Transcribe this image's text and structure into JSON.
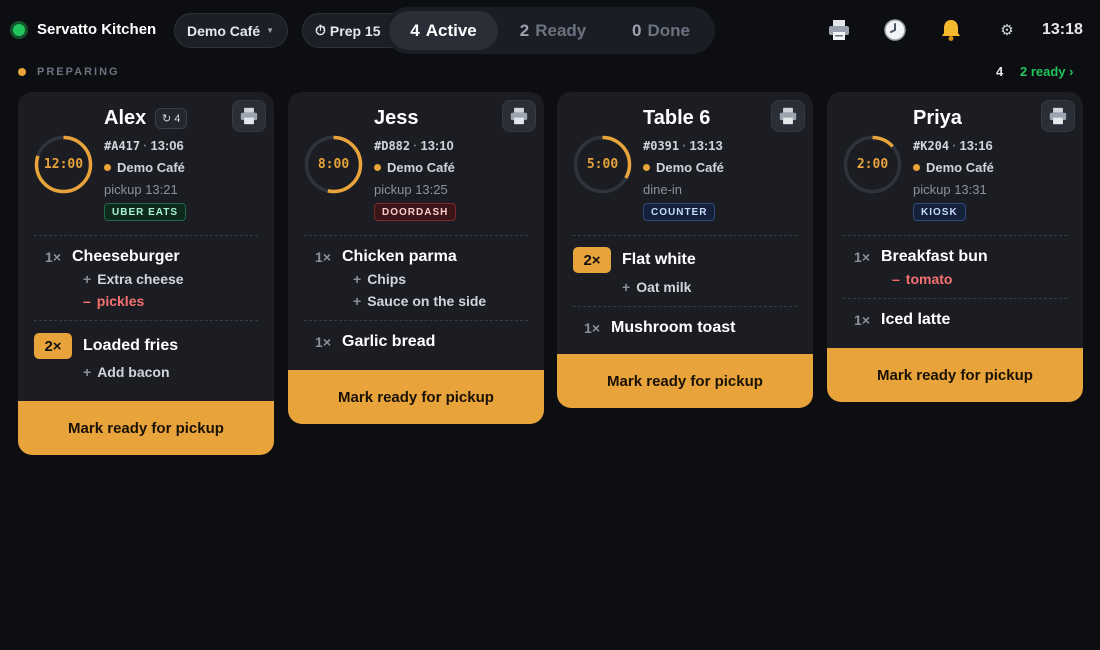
{
  "header": {
    "app_title": "Servatto Kitchen",
    "location": "Demo Café",
    "prep": "Prep 15",
    "prep_icon": "⏱",
    "tabs": [
      {
        "count": "4",
        "label": "Active"
      },
      {
        "count": "2",
        "label": "Ready"
      },
      {
        "count": "0",
        "label": "Done"
      }
    ],
    "icons": {
      "printer": "printer-icon",
      "history": "clock-icon",
      "alerts": "bell-icon",
      "settings": "gear-icon"
    },
    "time": "13:18"
  },
  "section": {
    "label": "PREPARING",
    "count": "4",
    "ready_link": "2 ready ›"
  },
  "colors": {
    "accent": "#e8a33a",
    "ready": "#22c55e",
    "remove": "#f87171"
  },
  "cards": [
    {
      "name": "Alex",
      "reorder": "4",
      "order_id": "#A417",
      "time": "13:06",
      "location": "Demo Café",
      "pickup": "pickup 13:21",
      "channel": "UBER EATS",
      "timer": "12:00",
      "timer_fraction": 0.8,
      "items": [
        {
          "qty": "1×",
          "name": "Cheeseburger",
          "mods": [
            {
              "type": "add",
              "text": "Extra cheese"
            },
            {
              "type": "remove",
              "text": "pickles"
            }
          ]
        },
        {
          "qty": "2×",
          "name": "Loaded fries",
          "mods": [
            {
              "type": "add",
              "text": "Add bacon"
            }
          ]
        }
      ],
      "action": "Mark ready for pickup"
    },
    {
      "name": "Jess",
      "order_id": "#D882",
      "time": "13:10",
      "location": "Demo Café",
      "pickup": "pickup 13:25",
      "channel": "DOORDASH",
      "timer": "8:00",
      "timer_fraction": 0.533,
      "items": [
        {
          "qty": "1×",
          "name": "Chicken parma",
          "mods": [
            {
              "type": "add",
              "text": "Chips"
            },
            {
              "type": "add",
              "text": "Sauce on the side"
            }
          ]
        },
        {
          "qty": "1×",
          "name": "Garlic bread",
          "mods": []
        }
      ],
      "action": "Mark ready for pickup"
    },
    {
      "name": "Table 6",
      "order_id": "#0391",
      "time": "13:13",
      "location": "Demo Café",
      "pickup": "dine-in",
      "channel": "COUNTER",
      "timer": "5:00",
      "timer_fraction": 0.333,
      "items": [
        {
          "qty": "2×",
          "name": "Flat white",
          "mods": [
            {
              "type": "add",
              "text": "Oat milk"
            }
          ]
        },
        {
          "qty": "1×",
          "name": "Mushroom toast",
          "mods": []
        }
      ],
      "action": "Mark ready for pickup"
    },
    {
      "name": "Priya",
      "order_id": "#K204",
      "time": "13:16",
      "location": "Demo Café",
      "pickup": "pickup 13:31",
      "channel": "KIOSK",
      "timer": "2:00",
      "timer_fraction": 0.133,
      "items": [
        {
          "qty": "1×",
          "name": "Breakfast bun",
          "mods": [
            {
              "type": "remove",
              "text": "tomato"
            }
          ]
        },
        {
          "qty": "1×",
          "name": "Iced latte",
          "mods": []
        }
      ],
      "action": "Mark ready for pickup"
    }
  ]
}
